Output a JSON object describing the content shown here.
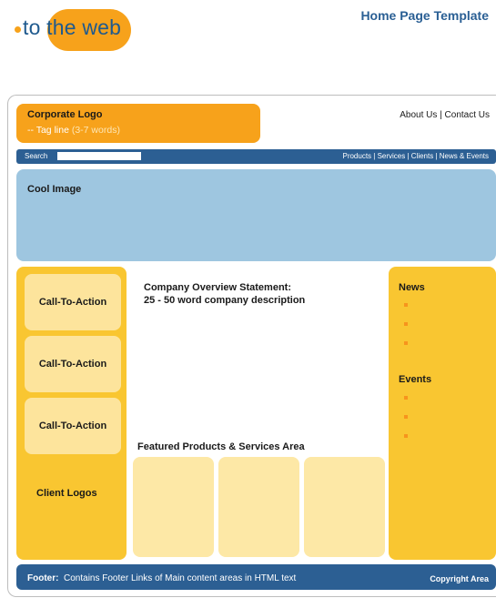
{
  "brand": {
    "prefix": "to ",
    "circled": "the web"
  },
  "page_title": "Home Page Template",
  "header": {
    "logo_label": "Corporate Logo",
    "tagline_prefix": "-- Tag line ",
    "tagline_hint": "(3-7 words)",
    "top_links": "About Us  |  Contact Us"
  },
  "nav": {
    "search_label": "Search",
    "search_value": "",
    "links": "Products  |  Services | Clients | News & Events"
  },
  "hero": {
    "label": "Cool Image"
  },
  "left": {
    "cta": [
      "Call-To-Action",
      "Call-To-Action",
      "Call-To-Action"
    ],
    "client_logos": "Client Logos"
  },
  "main": {
    "overview_title": "Company Overview Statement:",
    "overview_desc": "25 - 50 word company description",
    "featured_label": "Featured Products & Services Area"
  },
  "right": {
    "news": "News",
    "events": "Events"
  },
  "footer": {
    "label": "Footer:",
    "text": "Contains Footer Links of Main content areas in HTML text",
    "copyright": "Copyright Area"
  },
  "colors": {
    "orange": "#f7a21b",
    "navy": "#2c5f93",
    "light_blue": "#9ec6e0",
    "yellow": "#f9c631",
    "pale_yellow": "#fde49c"
  }
}
